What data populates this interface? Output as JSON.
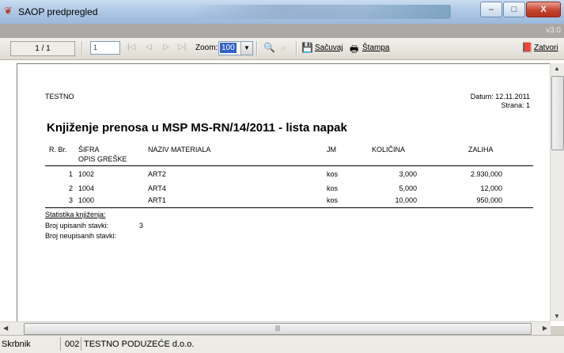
{
  "window": {
    "title": "SAOP predpregled",
    "version": "v3.0",
    "minimize_glyph": "–",
    "maximize_glyph": "□",
    "close_glyph": "X"
  },
  "toolbar": {
    "page_indicator": "1 / 1",
    "page_input": "1",
    "zoom_label": "Zoom:",
    "zoom_value": "100",
    "save_label": "Sačuvaj",
    "print_label": "Štampa",
    "close_label": "Zatvori",
    "icons": [
      "first-page-icon",
      "prev-page-icon",
      "next-page-icon",
      "last-page-icon",
      "find-icon",
      "find-next-icon",
      "save-icon",
      "print-icon",
      "close-icon"
    ]
  },
  "report": {
    "company": "TESTNO",
    "date_line": "Datum: 12.11.2011",
    "page_line": "Strana: 1",
    "title": "Knjiženje prenosa u MSP MS-RN/14/2011 - lista napak",
    "columns": {
      "rbr": "R. Br.",
      "sifra": "ŠIFRA",
      "opis": "OPIS GREŠKE",
      "naziv": "NAZIV MATERIALA",
      "jm": "JM",
      "kolicina": "KOLIČINA",
      "zaliha": "ZALIHA"
    },
    "rows": [
      {
        "rbr": "1",
        "sifra": "1002",
        "naziv": "ART2",
        "jm": "kos",
        "kolicina": "3,000",
        "zaliha": "2.930,000"
      },
      {
        "rbr": "2",
        "sifra": "1004",
        "naziv": "ART4",
        "jm": "kos",
        "kolicina": "5,000",
        "zaliha": "12,000"
      },
      {
        "rbr": "3",
        "sifra": "1000",
        "naziv": "ART1",
        "jm": "kos",
        "kolicina": "10,000",
        "zaliha": "950,000"
      }
    ],
    "stats_title": "Statistika knjiženja:",
    "stats_written_label": "Broj upisanih stavki:",
    "stats_written_value": "3",
    "stats_unwritten_label": "Broj neupisanih stavki:"
  },
  "statusbar": {
    "user": "Skrbnik",
    "company_code": "002",
    "company_name": "TESTNO PODUZEĆE d.o.o."
  },
  "colors": {
    "titlebar": "#a9c4e2",
    "close_button": "#c6452e",
    "zoom_highlight": "#3161c6"
  }
}
